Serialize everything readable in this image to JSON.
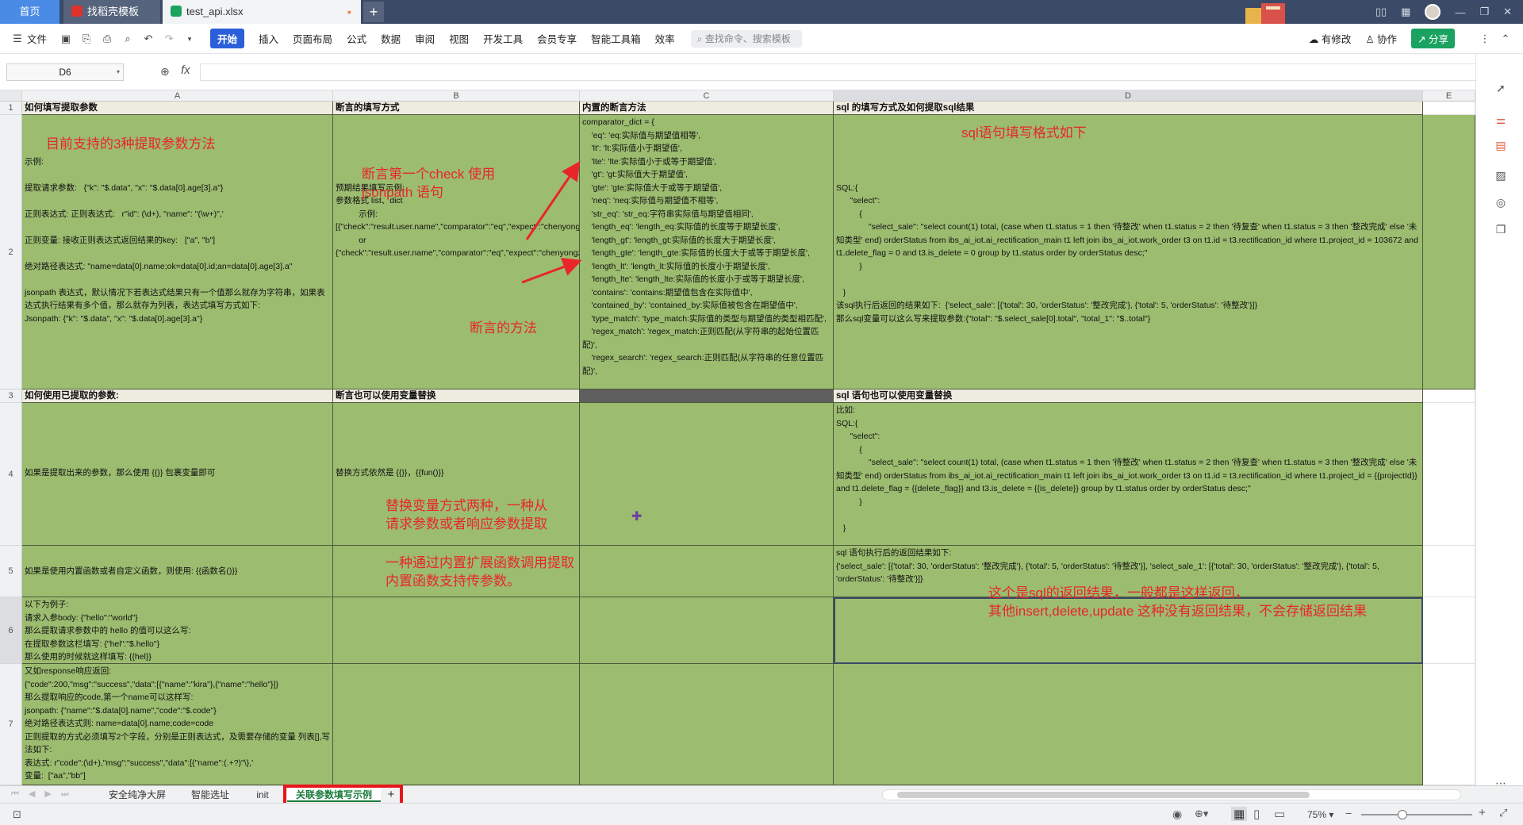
{
  "titlebar": {
    "tab_home": "首页",
    "tab_template": "找稻壳模板",
    "tab_file": "test_api.xlsx",
    "tab_file_dot": "●",
    "add": "+"
  },
  "toolbar": {
    "file": "文件",
    "menus": [
      "开始",
      "插入",
      "页面布局",
      "公式",
      "数据",
      "审阅",
      "视图",
      "开发工具",
      "会员专享",
      "智能工具箱",
      "效率"
    ],
    "search_placeholder": "查找命令、搜索模板",
    "has_changes": "有修改",
    "collab": "协作",
    "share": "分享"
  },
  "formula": {
    "cell_ref": "D6",
    "fx": "fx",
    "value": ""
  },
  "columns": [
    "A",
    "B",
    "C",
    "D",
    "E"
  ],
  "rows": [
    "1",
    "2",
    "3",
    "4",
    "5",
    "6",
    "7"
  ],
  "cells": {
    "A1": "如何填写提取参数",
    "B1": "断言的填写方式",
    "C1": "内置的断言方法",
    "D1": "sql 的填写方式及如何提取sql结果",
    "A2": "\n\n\n示例:\n\n提取请求参数:   {\"k\": \"$.data\", \"x\": \"$.data[0].age[3].a\"}\n\n正则表达式: 正则表达式:   r\"id\": (\\d+), \"name\": \"(\\w+)\",'\n\n正则变量: 接收正则表达式返回结果的key:   [\"a\", \"b\"]\n\n绝对路径表达式: \"name=data[0].name;ok=data[0].id;an=data[0].age[3].a\"\n\njsonpath 表达式，默认情况下若表达式结果只有一个值那么就存为字符串，如果表达式执行结果有多个值，那么就存为列表，表达式填写方式如下:\nJsonpath: {\"k\": \"$.data\", \"x\": \"$.data[0].age[3].a\"}",
    "B2": "\n\n\n\n\n预期结果填写示例:\n参数格式 list、dict\n          示例:\n[{\"check\":\"result.user.name\",\"comparator\":\"eq\",\"expect\":\"chenyongzhi\"}]\n          or\n{\"check\":\"result.user.name\",\"comparator\":\"eq\",\"expect\":\"chenyongzhi\"}",
    "C2": "comparator_dict = {\n    'eq': 'eq:实际值与期望值相等',\n    'lt': 'lt:实际值小于期望值',\n    'lte': 'lte:实际值小于或等于期望值',\n    'gt': 'gt:实际值大于期望值',\n    'gte': 'gte:实际值大于或等于期望值',\n    'neq': 'neq:实际值与期望值不相等',\n    'str_eq': 'str_eq:字符串实际值与期望值相同',\n    'length_eq': 'length_eq:实际值的长度等于期望长度',\n    'length_gt': 'length_gt:实际值的长度大于期望长度',\n    'length_gte': 'length_gte:实际值的长度大于或等于期望长度',\n    'length_lt': 'length_lt:实际值的长度小于期望长度',\n    'length_lte': 'length_lte:实际值的长度小于或等于期望长度',\n    'contains': 'contains:期望值包含在实际值中',\n    'contained_by': 'contained_by:实际值被包含在期望值中',\n    'type_match': 'type_match:实际值的类型与期望值的类型相匹配',\n    'regex_match': 'regex_match:正则匹配(从字符串的起始位置匹配)',\n    'regex_search': 'regex_search:正则匹配(从字符串的任意位置匹配)',",
    "D2": "\n\n\n\n\nSQL:{\n      \"select\":\n          {\n              \"select_sale\": \"select count(1) total, (case when t1.status = 1 then '待整改' when t1.status = 2 then '待复查' when t1.status = 3 then '整改完成' else '未知类型' end) orderStatus from ibs_ai_iot.ai_rectification_main t1 left join ibs_ai_iot.work_order t3 on t1.id = t3.rectification_id where t1.project_id = 103672 and t1.delete_flag = 0 and t3.is_delete = 0 group by t1.status order by orderStatus desc;\"\n          }\n\n   }\n该sql执行后返回的结果如下:  {'select_sale': [{'total': 30, 'orderStatus': '整改完成'}, {'total': 5, 'orderStatus': '待整改'}]}\n那么sql变量可以这么写来提取参数:{\"total\": \"$.select_sale[0].total\", \"total_1\": \"$..total\"}",
    "A3": "如何使用已提取的参数:",
    "B3": "断言也可以使用变量替换",
    "C3": "",
    "D3": "sql 语句也可以使用变量替换",
    "A4": "如果是提取出来的参数，那么使用 {{}} 包裹变量即可",
    "B4": "替换方式依然是 {{}}，{{fun()}}",
    "C4": "",
    "D4": "比如:\nSQL:{\n      \"select\":\n          {\n              \"select_sale\": \"select count(1) total, (case when t1.status = 1 then '待整改' when t1.status = 2 then '待复查' when t1.status = 3 then '整改完成' else '未知类型' end) orderStatus from ibs_ai_iot.ai_rectification_main t1 left join ibs_ai_iot.work_order t3 on t1.id = t3.rectification_id where t1.project_id = {{projectId}} and t1.delete_flag = {{delete_flag}} and t3.is_delete = {{is_delete}} group by t1.status order by orderStatus desc;\"\n          }\n\n   }",
    "A5": "如果是使用内置函数或者自定义函数，则使用: {{函数名()}}",
    "B5": "",
    "C5": "",
    "D5": "sql 语句执行后的返回结果如下:\n{'select_sale': [{'total': 30, 'orderStatus': '整改完成'}, {'total': 5, 'orderStatus': '待整改'}], 'select_sale_1': [{'total': 30, 'orderStatus': '整改完成'}, {'total': 5, 'orderStatus': '待整改'}]}",
    "A6": "以下为例子:\n请求入参body: {\"hello\":\"world\"}\n那么提取请求参数中的 hello 的值可以这么写:\n在提取参数这栏填写: {\"hel\":\"$.hello\"}\n那么使用的时候就这样填写: {{hel}}",
    "B6": "",
    "C6": "",
    "D6": "",
    "A7": "又如response响应返回:\n{\"code\":200,\"msg\":\"success\",\"data\":[{\"name\":\"kira\"},{\"name\":\"hello\"}]}\n那么提取响应的code,第一个name可以这样写:\njsonpath: {\"name\":\"$.data[0].name\",\"code\":\"$.code\"}\n绝对路径表达式则: name=data[0].name;code=code\n正则提取的方式必须填写2个字段，分别是正则表达式，及需要存储的变量 列表[],写法如下:\n表达式: r\"code\":(\\d+),\"msg\":\"success\",\"data\":[{\"name\":(.+?)\"\\},'\n变量:  [\"aa\",\"bb\"]",
    "B7": "",
    "C7": "",
    "D7": ""
  },
  "annotations": {
    "n1": "目前支持的3种提取参数方法",
    "n2": "断言第一个check 使用\njsonpath 语句",
    "n3": "断言的方法",
    "n4": "sql语句填写格式如下",
    "n5": "替换变量方式两种，一种从\n请求参数或者响应参数提取",
    "n6": "一种通过内置扩展函数调用提取\n内置函数支持传参数。",
    "n7": "这个是sql的返回结果，一般都是这样返回，\n其他insert,delete,update 这种没有返回结果，不会存储返回结果"
  },
  "sheets": [
    "安全纯净大屏",
    "智能选址",
    "init",
    "关联参数填写示例"
  ],
  "status": {
    "zoom": "75%",
    "zoom_minus": "−",
    "zoom_plus": "+"
  },
  "colors": {
    "cell_green": "#9cbc70",
    "annotation_red": "#e8262a",
    "accent_blue": "#2b5fd9",
    "share_green": "#1aa260"
  }
}
